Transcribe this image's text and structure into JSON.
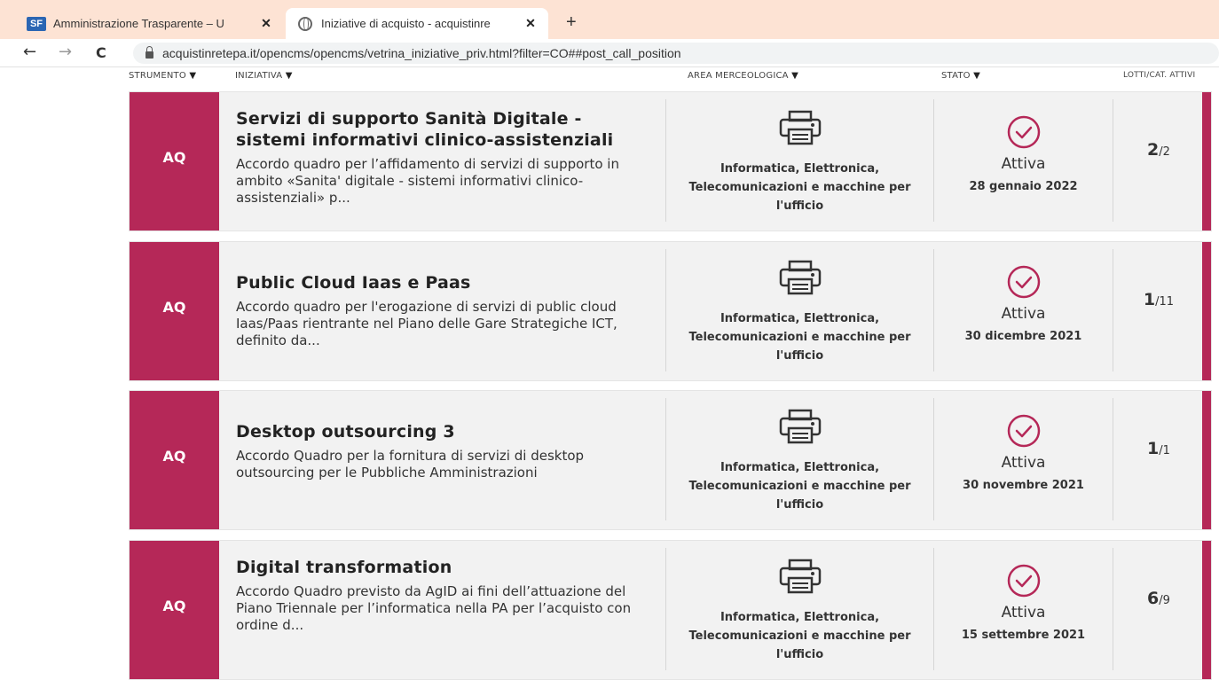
{
  "browser": {
    "tabs": [
      {
        "icon": "sf-logo-icon",
        "title": "Amministrazione Trasparente – U",
        "close": "✕"
      },
      {
        "icon": "globe-icon",
        "title": "Iniziative di acquisto - acquistinre",
        "close": "✕"
      }
    ],
    "new_tab": "+",
    "nav": {
      "back": "←",
      "forward": "→",
      "reload": "C"
    },
    "url": "acquistinretepa.it/opencms/opencms/vetrina_iniziative_priv.html?filter=CO##post_call_position"
  },
  "columns": {
    "strumento": "STRUMENTO",
    "iniziativa": "INIZIATIVA",
    "area": "AREA MERCEOLOGICA",
    "stato": "STATO",
    "lotti": "LOTTI/CAT. ATTIVI",
    "sort_arrow": "▼"
  },
  "rows": [
    {
      "badge": "AQ",
      "title": "Servizi di supporto Sanità Digitale - sistemi informativi clinico-assistenziali",
      "description": "Accordo quadro per l’affidamento di servizi di supporto in ambito «Sanita' digitale - sistemi informativi clinico-assistenziali» p...",
      "area": "Informatica, Elettronica, Telecomunicazioni e macchine per l'ufficio",
      "area_icon": "printer-icon",
      "stato": "Attiva",
      "stato_icon": "check-circle-icon",
      "date": "28 gennaio 2022",
      "lotti_active": "2",
      "lotti_total": "/2"
    },
    {
      "badge": "AQ",
      "title": "Public Cloud Iaas e Paas",
      "description": "Accordo quadro per l'erogazione di servizi di public cloud Iaas/Paas rientrante nel Piano delle Gare Strategiche ICT, definito da...",
      "area": "Informatica, Elettronica, Telecomunicazioni e macchine per l'ufficio",
      "area_icon": "printer-icon",
      "stato": "Attiva",
      "stato_icon": "check-circle-icon",
      "date": "30 dicembre 2021",
      "lotti_active": "1",
      "lotti_total": "/11"
    },
    {
      "badge": "AQ",
      "title": "Desktop outsourcing 3",
      "description": "Accordo Quadro per la fornitura di servizi di desktop outsourcing per le Pubbliche Amministrazioni",
      "area": "Informatica, Elettronica, Telecomunicazioni e macchine per l'ufficio",
      "area_icon": "printer-icon",
      "stato": "Attiva",
      "stato_icon": "check-circle-icon",
      "date": "30 novembre 2021",
      "lotti_active": "1",
      "lotti_total": "/1"
    },
    {
      "badge": "AQ",
      "title": "Digital transformation",
      "description": "Accordo Quadro previsto da AgID ai fini dell’attuazione del Piano Triennale per l’informatica nella PA per l’acquisto con ordine d...",
      "area": "Informatica, Elettronica, Telecomunicazioni e macchine per l'ufficio",
      "area_icon": "printer-icon",
      "stato": "Attiva",
      "stato_icon": "check-circle-icon",
      "date": "15 settembre 2021",
      "lotti_active": "6",
      "lotti_total": "/9"
    }
  ],
  "colors": {
    "accent": "#b52858",
    "tabbar": "#fde3d4",
    "row_bg": "#f2f2f2"
  }
}
